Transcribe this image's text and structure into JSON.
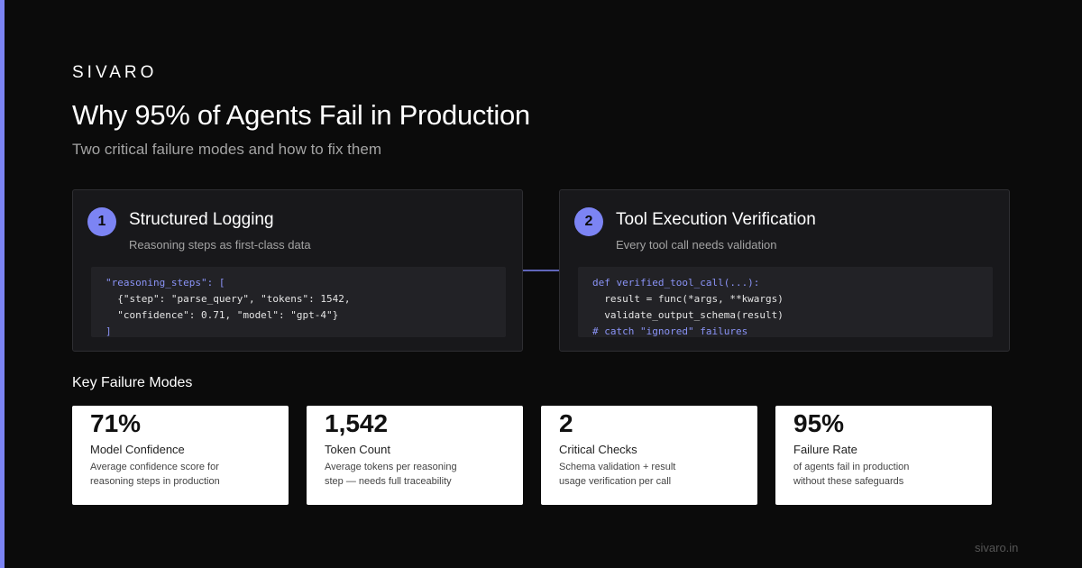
{
  "brand": "SIVARO",
  "title": "Why 95% of Agents Fail in Production",
  "subtitle": "Two critical failure modes and how to fix them",
  "colors": {
    "accent": "#7c84f4",
    "background": "#0b0b0b",
    "panel": "#18181b",
    "code_bg": "#222226"
  },
  "panels": [
    {
      "number": "1",
      "title": "Structured Logging",
      "subtitle": "Reasoning steps as first-class data",
      "code": [
        "\"reasoning_steps\": [",
        "  {\"step\": \"parse_query\", \"tokens\": 1542,",
        "  \"confidence\": 0.71, \"model\": \"gpt-4\"}",
        "]"
      ]
    },
    {
      "number": "2",
      "title": "Tool Execution Verification",
      "subtitle": "Every tool call needs validation",
      "code": [
        "def verified_tool_call(...):",
        "  result = func(*args, **kwargs)",
        "  validate_output_schema(result)",
        "# catch \"ignored\" failures"
      ]
    }
  ],
  "arrow_icon": "arrow-right-icon",
  "section_heading": "Key Failure Modes",
  "stats": [
    {
      "value": "71%",
      "label": "Model Confidence",
      "desc_lines": [
        "Average confidence score for",
        "reasoning steps in production"
      ]
    },
    {
      "value": "1,542",
      "label": "Token Count",
      "desc_lines": [
        "Average tokens per reasoning",
        "step — needs full traceability"
      ]
    },
    {
      "value": "2",
      "label": "Critical Checks",
      "desc_lines": [
        "Schema validation + result",
        "usage verification per call"
      ]
    },
    {
      "value": "95%",
      "label": "Failure Rate",
      "desc_lines": [
        "of agents fail in production",
        "without these safeguards"
      ]
    }
  ],
  "footer": "sivaro.in"
}
